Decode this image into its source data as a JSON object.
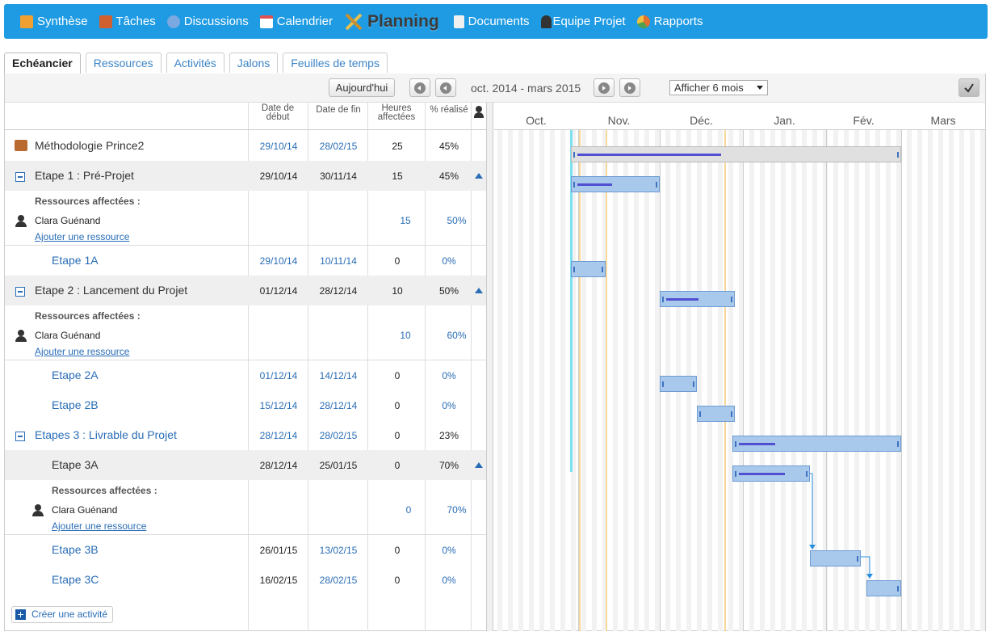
{
  "nav": {
    "items": [
      {
        "label": "Synthèse",
        "icon": "house-icon",
        "color": "#f0a030"
      },
      {
        "label": "Tâches",
        "icon": "tasks-icon",
        "color": "#d06030"
      },
      {
        "label": "Discussions",
        "icon": "chat-icon",
        "color": "#7aa8e0"
      },
      {
        "label": "Calendrier",
        "icon": "calendar-icon",
        "color": "#e05050"
      },
      {
        "label": "Planning",
        "icon": "planning-icon",
        "color": "#e8c050",
        "active": true
      },
      {
        "label": "Documents",
        "icon": "document-icon",
        "color": "#f0f0f0"
      },
      {
        "label": "Equipe Projet",
        "icon": "user-icon",
        "color": "#333333"
      },
      {
        "label": "Rapports",
        "icon": "chart-icon",
        "color": "#e07030"
      }
    ]
  },
  "tabs": [
    "Echéancier",
    "Ressources",
    "Activités",
    "Jalons",
    "Feuilles de temps"
  ],
  "toolbar": {
    "today_label": "Aujourd'hui",
    "period": "oct. 2014 - mars 2015",
    "view_select": "Afficher 6 mois"
  },
  "table": {
    "headers": {
      "start": "Date de début",
      "end": "Date de fin",
      "hours": "Heures affectées",
      "pct": "% réalisé"
    },
    "res_title": "Ressources affectées :",
    "add_resource": "Ajouter une ressource",
    "create_activity": "Créer une activité",
    "rows": [
      {
        "name": "Méthodologie Prince2",
        "start": "29/10/14",
        "end": "28/02/15",
        "hours": "25",
        "pct": "45%"
      },
      {
        "name": "Etape 1 : Pré-Projet",
        "start": "29/10/14",
        "end": "30/11/14",
        "hours": "15",
        "pct": "45%"
      },
      {
        "name": "Etape 1A",
        "start": "29/10/14",
        "end": "10/11/14",
        "hours": "0",
        "pct": "0%"
      },
      {
        "name": "Etape 2 : Lancement du Projet",
        "start": "01/12/14",
        "end": "28/12/14",
        "hours": "10",
        "pct": "50%"
      },
      {
        "name": "Etape 2A",
        "start": "01/12/14",
        "end": "14/12/14",
        "hours": "0",
        "pct": "0%"
      },
      {
        "name": "Etape 2B",
        "start": "15/12/14",
        "end": "28/12/14",
        "hours": "0",
        "pct": "0%"
      },
      {
        "name": "Etapes 3 : Livrable du Projet",
        "start": "28/12/14",
        "end": "28/02/15",
        "hours": "0",
        "pct": "23%"
      },
      {
        "name": "Etape 3A",
        "start": "28/12/14",
        "end": "25/01/15",
        "hours": "0",
        "pct": "70%"
      },
      {
        "name": "Etape 3B",
        "start": "26/01/15",
        "end": "13/02/15",
        "hours": "0",
        "pct": "0%"
      },
      {
        "name": "Etape 3C",
        "start": "16/02/15",
        "end": "28/02/15",
        "hours": "0",
        "pct": "0%"
      }
    ],
    "resources": [
      {
        "name": "Clara Guénand",
        "hours": "15",
        "pct": "50%"
      },
      {
        "name": "Clara Guénand",
        "hours": "10",
        "pct": "60%"
      },
      {
        "name": "Clara Guénand",
        "hours": "0",
        "pct": "70%"
      }
    ]
  },
  "gantt": {
    "months": [
      "Oct.",
      "Nov.",
      "Déc.",
      "Jan.",
      "Fév.",
      "Mars"
    ],
    "progress": [
      0.45,
      0.45,
      0,
      0.5,
      0,
      0,
      0.23,
      0.7,
      0,
      0
    ]
  }
}
